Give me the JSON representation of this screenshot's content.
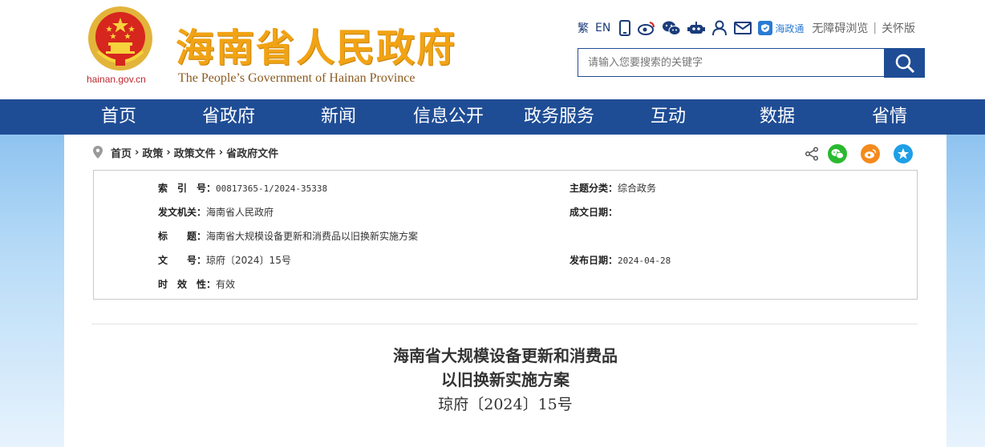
{
  "header": {
    "domain": "hainan.gov.cn",
    "title": "海南省人民政府",
    "subtitle": "The People’s Government  of Hainan Province",
    "tools": {
      "traditional": "繁",
      "english": "EN",
      "haizhengtong": "海政通",
      "accessibility": "无障碍浏览",
      "separator": "|",
      "elderly": "关怀版"
    },
    "search": {
      "placeholder": "请输入您要搜索的关键字"
    }
  },
  "nav": {
    "items": [
      "首页",
      "省政府",
      "新闻",
      "信息公开",
      "政务服务",
      "互动",
      "数据",
      "省情"
    ]
  },
  "breadcrumb": {
    "items": [
      "首页",
      "政策",
      "政策文件",
      "省政府文件"
    ],
    "arrow": "›"
  },
  "info": {
    "index_label": "索　引　号：",
    "index_value": "00817365-1/2024-35338",
    "theme_label": "主题分类：",
    "theme_value": "综合政务",
    "issuer_label": "发文机关：",
    "issuer_value": "海南省人民政府",
    "written_date_label": "成文日期：",
    "written_date_value": "",
    "title_label": "标　　题：",
    "title_value": "海南省大规模设备更新和消费品以旧换新实施方案",
    "doc_no_label": "文　　号：",
    "doc_no_value": "琼府〔2024〕15号",
    "publish_date_label": "发布日期：",
    "publish_date_value": "2024-04-28",
    "validity_label": "时　效　性：",
    "validity_value": "有效"
  },
  "document": {
    "title_line1": "海南省大规模设备更新和消费品",
    "title_line2": "以旧换新实施方案",
    "number": "琼府〔2024〕15号"
  },
  "colors": {
    "nav_bg": "#1f4d95",
    "title_gold": "#f1a314",
    "wechat": "#2ab930",
    "weibo": "#f58a1e",
    "qzone": "#1e9fe6"
  }
}
